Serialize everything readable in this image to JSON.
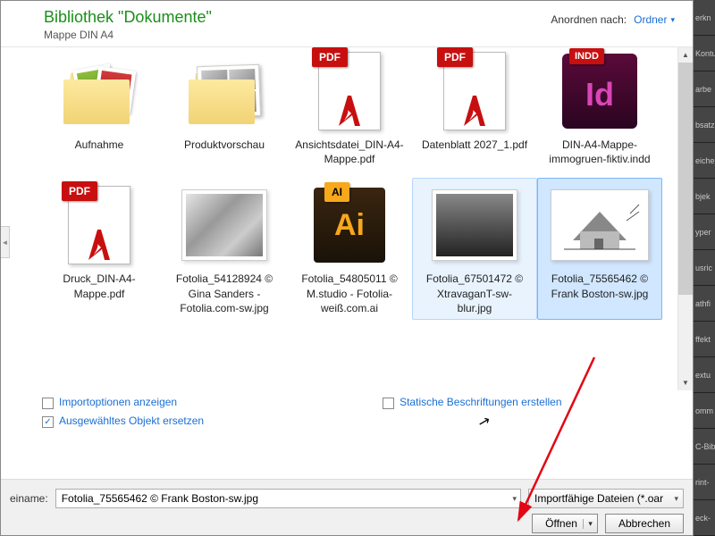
{
  "header": {
    "title": "Bibliothek \"Dokumente\"",
    "subtitle": "Mappe DIN A4",
    "arrange_label": "Anordnen nach:",
    "arrange_value": "Ordner"
  },
  "files": {
    "row1": [
      {
        "label": "Aufnahme",
        "type": "folder-photos"
      },
      {
        "label": "Produktvorschau",
        "type": "folder-grid"
      },
      {
        "label": "Ansichtsdatei_DIN-A4-Mappe.pdf",
        "type": "pdf",
        "badge": "PDF"
      },
      {
        "label": "Datenblatt 2027_1.pdf",
        "type": "pdf",
        "badge": "PDF"
      },
      {
        "label": "DIN-A4-Mappe-immogruen-fiktiv.indd",
        "type": "indd",
        "badge": "INDD",
        "text": "Id"
      }
    ],
    "row2": [
      {
        "label": "Druck_DIN-A4-Mappe.pdf",
        "type": "pdf",
        "badge": "PDF"
      },
      {
        "label": "Fotolia_54128924 © Gina Sanders - Fotolia.com-sw.jpg",
        "type": "img-bw"
      },
      {
        "label": "Fotolia_54805011 © M.studio - Fotolia-weiß.com.ai",
        "type": "ai",
        "badge": "AI",
        "text": "Ai"
      },
      {
        "label": "Fotolia_67501472 © XtravaganT-sw-blur.jpg",
        "type": "img-room"
      },
      {
        "label": "Fotolia_75565462 © Frank Boston-sw.jpg",
        "type": "img-house"
      }
    ]
  },
  "options": {
    "import_options": "Importoptionen anzeigen",
    "static_captions": "Statische Beschriftungen erstellen",
    "replace_selected": "Ausgewähltes Objekt ersetzen"
  },
  "bottom": {
    "filename_label": "einame:",
    "filename_value": "Fotolia_75565462 © Frank Boston-sw.jpg",
    "filter": "Importfähige Dateien (*.oar",
    "open": "Öffnen",
    "cancel": "Abbrechen"
  },
  "side_tabs": [
    "erkn",
    "Kontu",
    "arbe",
    "bsatz",
    "eiche",
    "bjek",
    "yper",
    "usric",
    "athfi",
    "ffekt",
    "extu",
    "omm",
    "C-Bib",
    "rint-",
    "eck-"
  ]
}
